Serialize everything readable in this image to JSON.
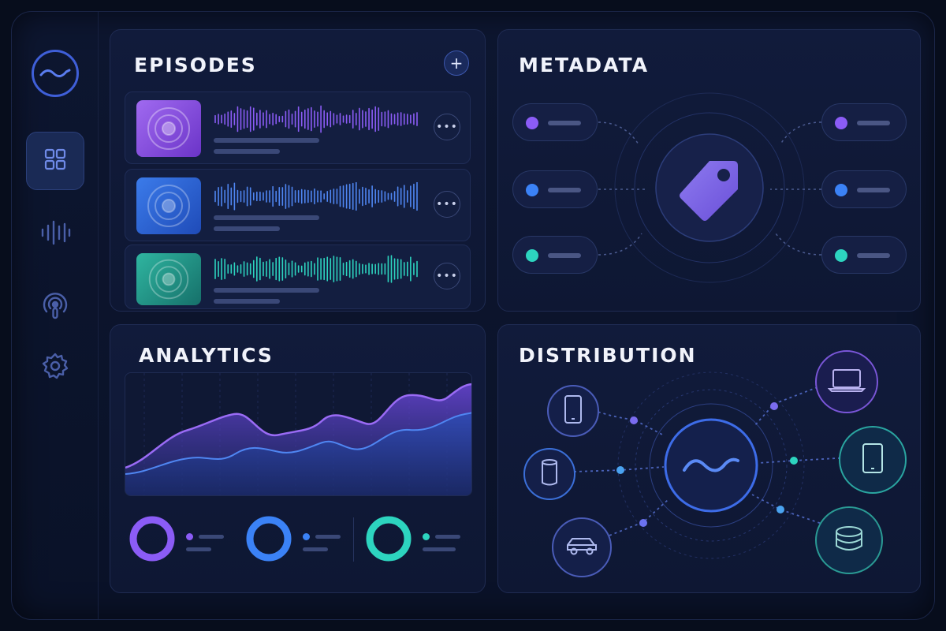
{
  "sidebar": {
    "logo_icon": "waveform-logo-icon",
    "items": [
      {
        "icon": "grid-icon",
        "active": true
      },
      {
        "icon": "audio-waveform-icon",
        "active": false
      },
      {
        "icon": "podcast-icon",
        "active": false
      },
      {
        "icon": "gear-icon",
        "active": false
      }
    ]
  },
  "episodes": {
    "title": "EPISODES",
    "add_icon": "plus-icon",
    "items": [
      {
        "color": "#8b4fe0",
        "more_icon": "ellipsis-icon"
      },
      {
        "color": "#2f63d8",
        "more_icon": "ellipsis-icon"
      },
      {
        "color": "#1f9a8e",
        "more_icon": "ellipsis-icon"
      }
    ]
  },
  "metadata": {
    "title": "METADATA",
    "center_icon": "tag-icon",
    "tags": [
      {
        "side": "left",
        "color": "#8b5cf6"
      },
      {
        "side": "left",
        "color": "#3b82f6"
      },
      {
        "side": "left",
        "color": "#2dd4bf"
      },
      {
        "side": "right",
        "color": "#8b5cf6"
      },
      {
        "side": "right",
        "color": "#3b82f6"
      },
      {
        "side": "right",
        "color": "#2dd4bf"
      }
    ]
  },
  "analytics": {
    "title": "ANALYTICS",
    "donuts": [
      {
        "color": "#8b5cf6"
      },
      {
        "color": "#3b82f6"
      },
      {
        "color": "#2dd4bf"
      }
    ]
  },
  "distribution": {
    "title": "DISTRIBUTION",
    "center_icon": "waveform-hub-icon",
    "devices": [
      {
        "icon": "smartphone-icon",
        "color": "#5b6fd6"
      },
      {
        "icon": "smart-speaker-icon",
        "color": "#3b82f6"
      },
      {
        "icon": "car-icon",
        "color": "#5b6fd6"
      },
      {
        "icon": "laptop-icon",
        "color": "#8b5cf6"
      },
      {
        "icon": "tablet-icon",
        "color": "#2dd4bf"
      },
      {
        "icon": "database-icon",
        "color": "#2dd4bf"
      }
    ]
  }
}
